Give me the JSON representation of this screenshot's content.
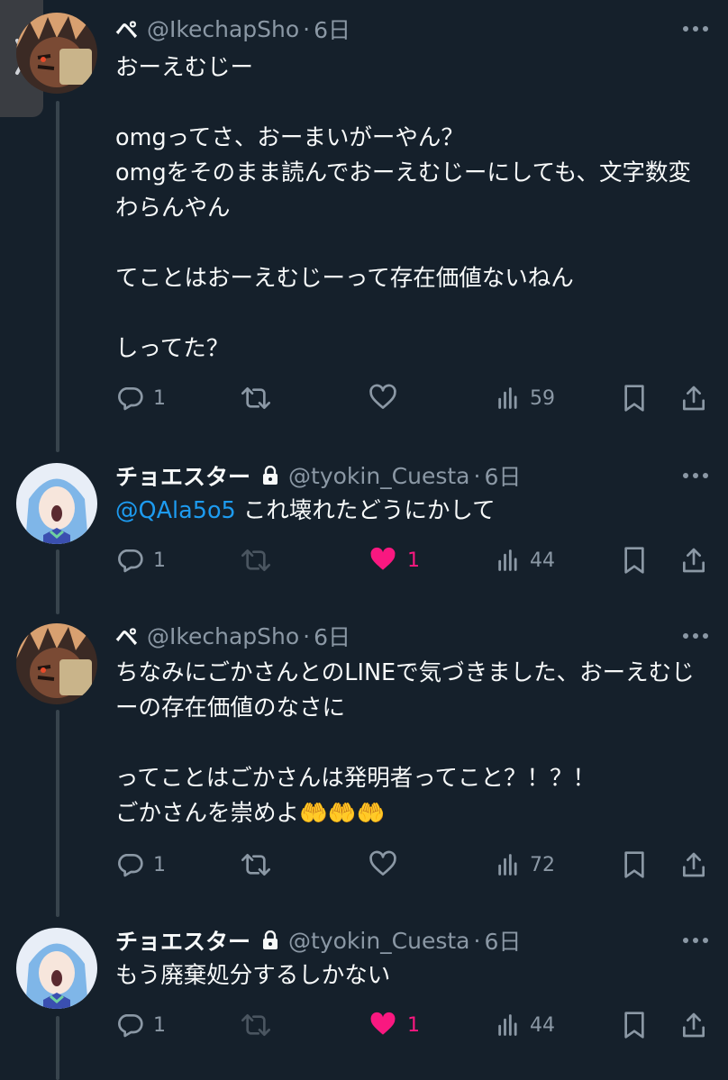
{
  "colors": {
    "background": "#15202b",
    "text": "#f7f9f9",
    "secondary": "#8b98a5",
    "link": "#1d9bf0",
    "like": "#f91880",
    "thread_line": "#38444d"
  },
  "side_tab": {
    "icon": "chevron-right-icon"
  },
  "tweets": [
    {
      "name": "ペ",
      "locked": false,
      "handle": "@IkechapSho",
      "separator": "·",
      "date": "6日",
      "text": "おーえむじー\n\nomgってさ、おーまいがーやん？\nomgをそのまま読んでおーえむじーにしても、文字数変わらんやん\n\nてことはおーえむじーって存在価値ないねん\n\nしってた？",
      "replies": "1",
      "retweets": "",
      "likes": "",
      "liked": false,
      "views": "59"
    },
    {
      "name": "チョエスター",
      "locked": true,
      "handle": "@tyokin_Cuesta",
      "separator": "·",
      "date": "6日",
      "mention": "@QAla5o5",
      "text": " これ壊れたどうにかして",
      "replies": "1",
      "retweets": "",
      "likes": "1",
      "liked": true,
      "views": "44"
    },
    {
      "name": "ペ",
      "locked": false,
      "handle": "@IkechapSho",
      "separator": "·",
      "date": "6日",
      "text": "ちなみにごかさんとのLINEで気づきました、おーえむじーの存在価値のなさに\n\nってことはごかさんは発明者ってこと？！？！\nごかさんを崇めよ🤲🤲🤲",
      "replies": "1",
      "retweets": "",
      "likes": "",
      "liked": false,
      "views": "72"
    },
    {
      "name": "チョエスター",
      "locked": true,
      "handle": "@tyokin_Cuesta",
      "separator": "·",
      "date": "6日",
      "text": "もう廃棄処分するしかない",
      "replies": "1",
      "retweets": "",
      "likes": "1",
      "liked": true,
      "views": "44"
    }
  ]
}
